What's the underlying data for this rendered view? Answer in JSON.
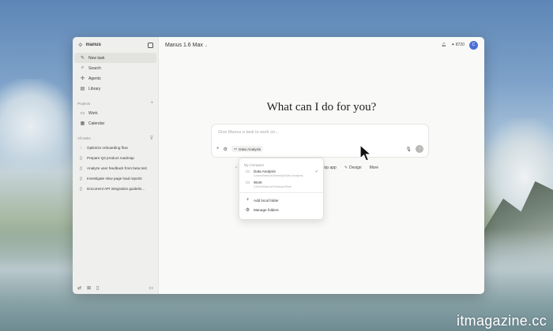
{
  "app": {
    "brand": "manus",
    "model_selector": "Manus 1.6 Max",
    "credits": "8720",
    "avatar_initial": "C",
    "accent_color": "#4a6fd6"
  },
  "sidebar": {
    "nav": [
      {
        "label": "New task",
        "icon": "new-task-icon"
      },
      {
        "label": "Search",
        "icon": "search-icon"
      },
      {
        "label": "Agents",
        "icon": "agents-icon"
      },
      {
        "label": "Library",
        "icon": "library-icon"
      }
    ],
    "projects_header": "Projects",
    "projects": [
      {
        "label": "Work",
        "icon": "folder-icon"
      },
      {
        "label": "Calendar",
        "icon": "calendar-icon"
      }
    ],
    "tasks_header": "All tasks",
    "tasks": [
      {
        "label": "Optimize onboarding flow",
        "icon": "loading-icon"
      },
      {
        "label": "Prepare Q3 product roadmap",
        "icon": "document-icon"
      },
      {
        "label": "Analyze user feedback from beta test",
        "icon": "document-icon"
      },
      {
        "label": "Investigate slow page load reports",
        "icon": "document-icon"
      },
      {
        "label": "Document API integration guidelin...",
        "icon": "document-icon"
      }
    ]
  },
  "main": {
    "headline": "What can I do for you?",
    "composer_placeholder": "Give Manus a task to work on...",
    "selected_folder": "Data Analysis",
    "actions": [
      {
        "label": "Develop app",
        "icon": "app-icon"
      },
      {
        "label": "Design",
        "icon": "design-icon"
      },
      {
        "label": "More",
        "icon": ""
      }
    ]
  },
  "folder_menu": {
    "header": "My Computer",
    "folders": [
      {
        "name": "Data Analysis",
        "path": "/Users/Manus/Desktop/Data Analysis",
        "selected": true
      },
      {
        "name": "Work",
        "path": "/Users/Manus/Desktop/Work",
        "selected": false
      }
    ],
    "add_label": "Add local folder",
    "manage_label": "Manage folders"
  },
  "watermark": "itmagazine.cc"
}
